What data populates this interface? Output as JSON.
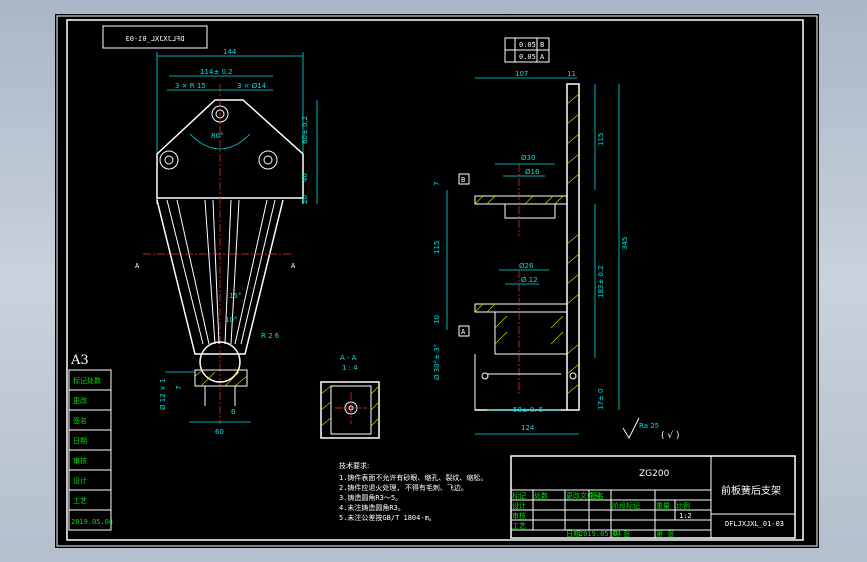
{
  "drawing_number": "DFLJXJXL_01-03",
  "material": "ZG200",
  "part_name": "前板簧后支架",
  "paper_size": "A3",
  "date": "2019.05.04",
  "tolerance_frame": {
    "row1": "0.05",
    "row2": "0.05",
    "datum1": "B",
    "datum2": "A"
  },
  "dimensions": {
    "top_width": "144",
    "hole_span": "114± 0.2",
    "radius_note": "3 × R 15",
    "hole_note": "3 × Ø14",
    "angle": "80°",
    "height_60": "60± 0.2",
    "height_40": "40",
    "height_20": "20",
    "angle_15": "15°",
    "angle_10": "10°",
    "r26": "R 2 6",
    "dia_12x1": "Ø 12 × 1",
    "d7": "7",
    "d6": "6",
    "d60": "60",
    "right_107": "107",
    "right_11": "11",
    "right_115a": "115",
    "right_345": "345",
    "right_115b": "115",
    "right_183": "183± 0.2",
    "dia30": "Ø30",
    "dia16": "Ø16",
    "dia26": "Ø26",
    "dia12": "Ø 12",
    "d58": "58± 0. 5",
    "d124": "124",
    "d10": "10",
    "d17": "17± 0",
    "d7b": "7",
    "d30deg": "Ø 30°± 3°",
    "section_label": "A - A",
    "section_scale": "1 : 4",
    "surface_ra": "Ra 25",
    "surface_other": "( √ )"
  },
  "datum_labels": {
    "b": "B",
    "a": "A"
  },
  "notes": {
    "title": "技术要求:",
    "items": [
      "1.铸件表面不允许有砂眼、缩孔、裂纹、缩松。",
      "2.铸件应退火处理, 不得有毛刺、飞边。",
      "3.铸造圆角R3～5。",
      "4.未注铸造圆角R3。",
      "5.未注公差按GB/T 1804-m。"
    ]
  },
  "left_column": [
    "标记处数",
    "更改",
    "签名",
    "日期",
    "审核",
    "设计",
    "工艺"
  ],
  "title_block": {
    "labels_row": [
      "标记",
      "处数",
      "分区",
      "更改文件号",
      "签名",
      "年月日"
    ],
    "design": "设计",
    "standard": "标准化",
    "check": "审核",
    "process": "工艺",
    "approve": "批准",
    "stage": "阶段标记",
    "weight": "重量",
    "scale": "比例",
    "scale_value": "1:2",
    "sheet": "共 张",
    "sheet_of": "第 张",
    "date_label": "日期",
    "date_value": "2019.05.04",
    "code": "DFLJXJXL_01-03"
  },
  "colors": {
    "background": "#000000",
    "line": "#ffffff",
    "dim": "#00e0e0",
    "center": "#ff3030",
    "hatch": "#e0e000",
    "text": "#00e000"
  }
}
